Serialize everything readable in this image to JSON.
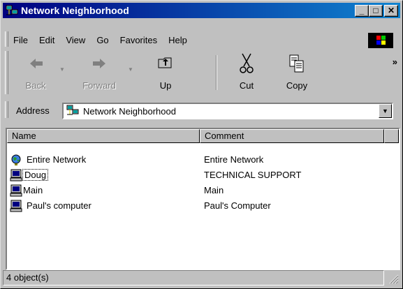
{
  "window": {
    "title": "Network Neighborhood",
    "controls": {
      "minimize": "_",
      "maximize": "□",
      "close": "✕"
    }
  },
  "menubar": {
    "items": [
      {
        "label": "File"
      },
      {
        "label": "Edit"
      },
      {
        "label": "View"
      },
      {
        "label": "Go"
      },
      {
        "label": "Favorites"
      },
      {
        "label": "Help"
      }
    ]
  },
  "toolbar": {
    "back_label": "Back",
    "forward_label": "Forward",
    "up_label": "Up",
    "cut_label": "Cut",
    "copy_label": "Copy",
    "more": "»"
  },
  "address": {
    "label": "Address",
    "value": "Network Neighborhood"
  },
  "list": {
    "columns": [
      "Name",
      "Comment"
    ],
    "rows": [
      {
        "name": "Entire Network",
        "comment": "Entire Network",
        "icon": "globe-network-icon"
      },
      {
        "name": "Doug",
        "comment": "TECHNICAL SUPPORT",
        "icon": "computer-icon",
        "focused": true
      },
      {
        "name": "Main",
        "comment": "Main",
        "icon": "computer-icon"
      },
      {
        "name": "Paul's computer",
        "comment": "Paul's Computer",
        "icon": "computer-icon"
      }
    ]
  },
  "status": {
    "text": "4 object(s)"
  },
  "colors": {
    "title_start": "#000080",
    "title_end": "#1084d0",
    "face": "#c0c0c0"
  }
}
